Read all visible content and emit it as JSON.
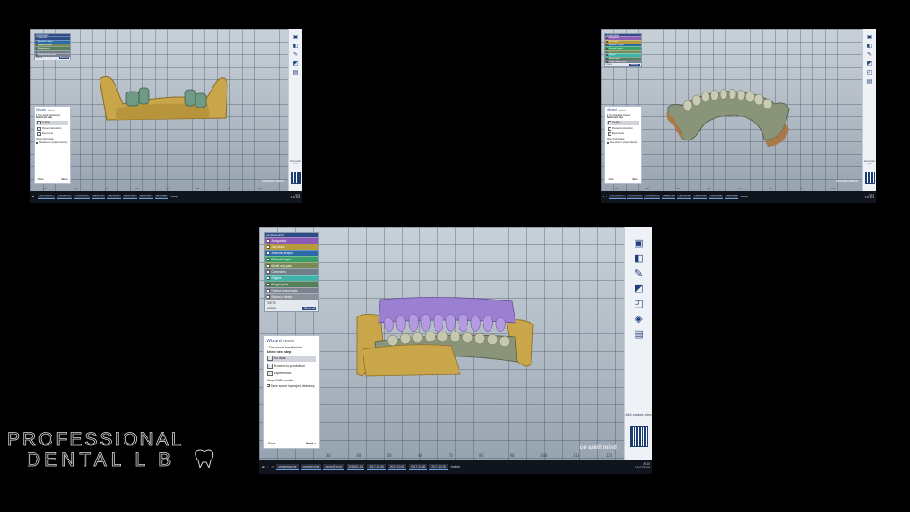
{
  "app": {
    "brand_text": "ceramill mind",
    "add_custom_view": "Add custom view",
    "ruler_ticks": [
      "30",
      "40",
      "50",
      "60",
      "70",
      "80",
      "90",
      "100",
      "110",
      "120"
    ]
  },
  "object_panel": {
    "header": "WORKSHEET",
    "rows": [
      {
        "label": "Antagonists",
        "color": "#8c5bb5"
      },
      {
        "label": "Jaw scans",
        "color": "#b59b3a"
      },
      {
        "label": "Anatomic shapes",
        "color": "#2d6aa8"
      },
      {
        "label": "External shapes",
        "color": "#3aa06a"
      },
      {
        "label": "Model only parts",
        "color": "#7a8a55"
      },
      {
        "label": "Connectors",
        "color": "#6f7f88"
      },
      {
        "label": "Gingiva",
        "color": "#3fb3a9"
      },
      {
        "label": "Merged parts",
        "color": "#56805c"
      },
      {
        "label": "Gingiva design parts",
        "color": "#7a8290"
      },
      {
        "label": "Bottom of design",
        "color": "#8a9099"
      }
    ],
    "footer_rows": [
      "TEETH",
      "MODEL"
    ],
    "show_all": "Show all"
  },
  "wizard": {
    "title": "Wizard",
    "subtitle": "Finished",
    "info": "The wizard has finished.",
    "prompt": "Select next step:",
    "options": [
      "I'm done",
      "Proceed to production",
      "Expert mode"
    ],
    "close_label": "Close CAD module",
    "save_label": "Save scene in project directory",
    "back": "Back",
    "next": "Next"
  },
  "taskbar": {
    "tasks": [
      "presentazione",
      "ceramill mind",
      "ceramill mind",
      "2018-01-16",
      "2017-10-06",
      "2017-10-06",
      "2017-10-06",
      "2017-10-06"
    ],
    "desktop": "Desktop",
    "time": "19:10",
    "date": "19.01.2018"
  },
  "logo": {
    "line1": "PROFESSIONAL",
    "line2": "DENTAL L B"
  },
  "colors": {
    "antagonist": "#9b7fd0",
    "model_yellow": "#c9a64a",
    "gingiva": "#8a9478",
    "abutment": "#6e9a86"
  }
}
